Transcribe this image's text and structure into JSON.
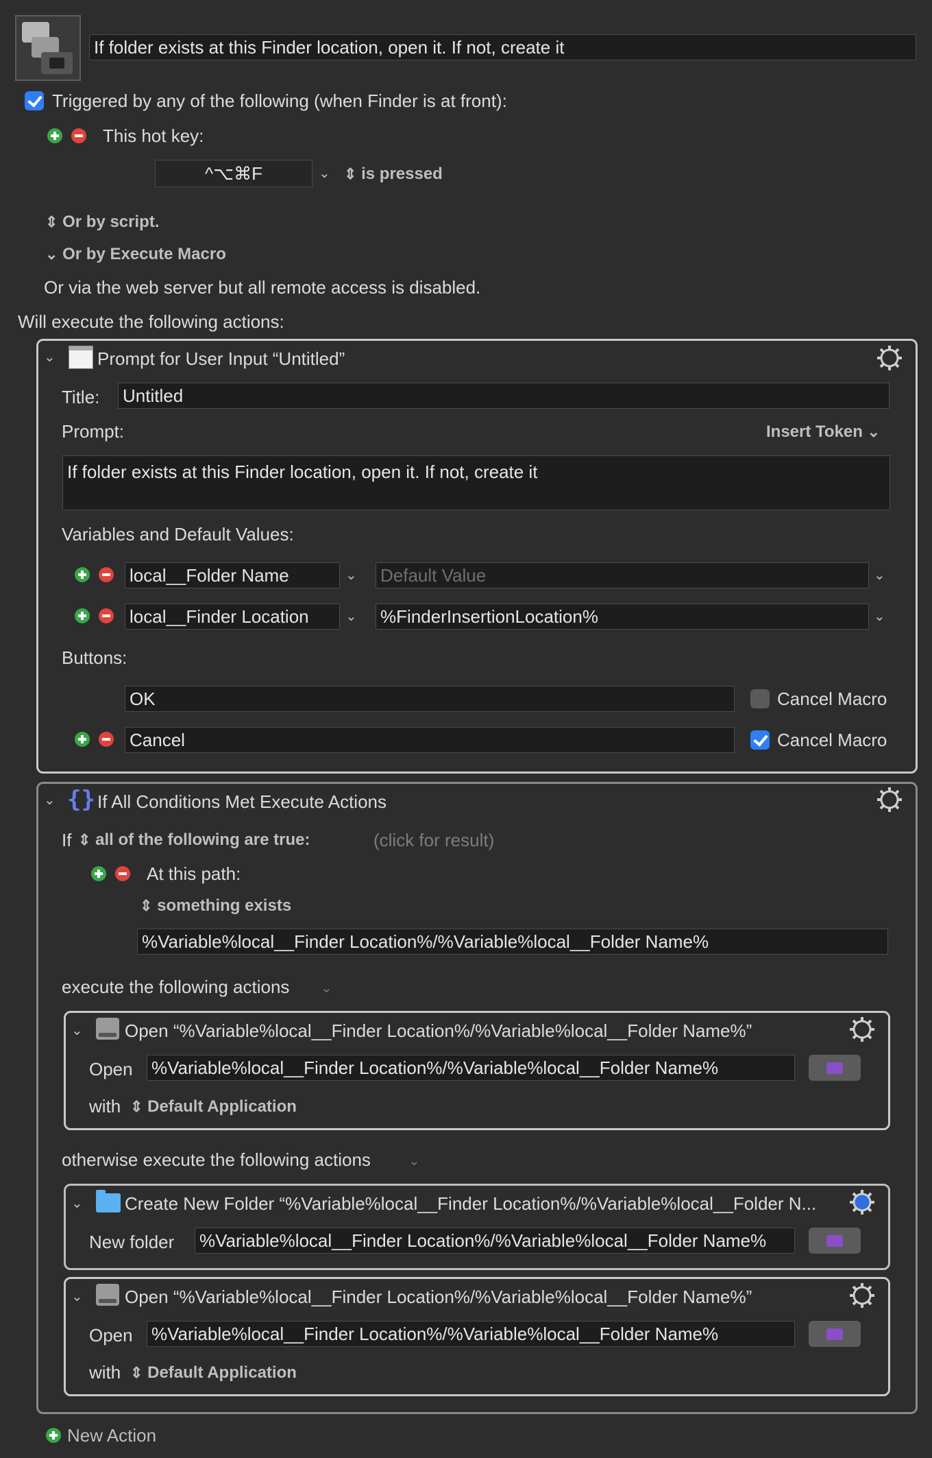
{
  "macro": {
    "name": "If folder exists at this Finder location, open it. If not, create it",
    "trigger_label": "Triggered by any of the following (when Finder is at front):",
    "trigger_checked": true,
    "hotkey_label": "This hot key:",
    "hotkey_value": "^⌥⌘F",
    "hotkey_condition": "is pressed",
    "or_by_script": "Or by script.",
    "or_by_execute": "Or by Execute Macro",
    "web_server_note": "Or via the web server but all remote access is disabled.",
    "actions_heading": "Will execute the following actions:"
  },
  "prompt_action": {
    "header": "Prompt for User Input “Untitled”",
    "title_label": "Title:",
    "title_value": "Untitled",
    "prompt_label": "Prompt:",
    "insert_token": "Insert Token",
    "prompt_value": "If folder exists at this Finder location, open it. If not, create it",
    "variables_label": "Variables and Default Values:",
    "variables": [
      {
        "name": "local__Folder Name",
        "default": "",
        "default_placeholder": "Default Value"
      },
      {
        "name": "local__Finder Location",
        "default": "%FinderInsertionLocation%"
      }
    ],
    "buttons_label": "Buttons:",
    "buttons": [
      {
        "label": "OK",
        "cancel_label": "Cancel Macro",
        "cancel_checked": false
      },
      {
        "label": "Cancel",
        "cancel_label": "Cancel Macro",
        "cancel_checked": true
      }
    ]
  },
  "if_action": {
    "header": "If All Conditions Met Execute Actions",
    "if_word": "If",
    "condition_mode": "all of the following are true:",
    "click_result": "(click for result)",
    "at_path_label": "At this path:",
    "exists_label": "something exists",
    "path_value": "%Variable%local__Finder Location%/%Variable%local__Folder Name%",
    "execute_label": "execute the following actions",
    "otherwise_label": "otherwise execute the following actions"
  },
  "open_action_1": {
    "header": "Open “%Variable%local__Finder Location%/%Variable%local__Folder Name%”",
    "open_label": "Open",
    "open_value": "%Variable%local__Finder Location%/%Variable%local__Folder Name%",
    "with_label": "with",
    "with_value": "Default Application"
  },
  "create_action": {
    "header": "Create New Folder “%Variable%local__Finder Location%/%Variable%local__Folder N...",
    "new_folder_label": "New folder",
    "new_folder_value": "%Variable%local__Finder Location%/%Variable%local__Folder Name%"
  },
  "open_action_2": {
    "header": "Open “%Variable%local__Finder Location%/%Variable%local__Folder Name%”",
    "open_label": "Open",
    "open_value": "%Variable%local__Finder Location%/%Variable%local__Folder Name%",
    "with_label": "with",
    "with_value": "Default Application"
  },
  "new_action_label": "New Action",
  "colors": {
    "background": "#2d2d2d",
    "accent": "#2f7ef6",
    "plus": "#3aa64a",
    "minus": "#e0443e"
  }
}
